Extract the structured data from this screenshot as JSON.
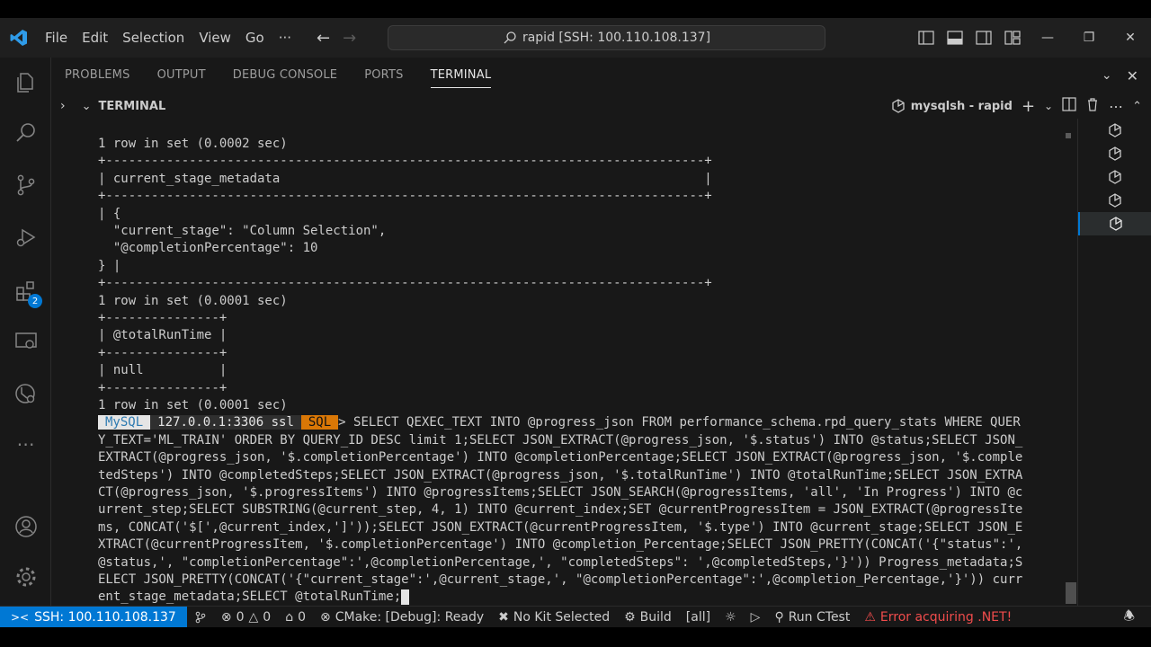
{
  "titlebar": {
    "menu": [
      "File",
      "Edit",
      "Selection",
      "View",
      "Go",
      "···"
    ],
    "command_center": "rapid [SSH: 100.110.108.137]"
  },
  "activity": {
    "extensions_badge": "2"
  },
  "panel": {
    "tabs": [
      "PROBLEMS",
      "OUTPUT",
      "DEBUG CONSOLE",
      "PORTS",
      "TERMINAL"
    ],
    "active_tab": "TERMINAL",
    "terminal_section_title": "TERMINAL",
    "terminal_name": "mysqlsh - rapid"
  },
  "terminal": {
    "lines": [
      "1 row in set (0.0002 sec)",
      "+-------------------------------------------------------------------------------+",
      "| current_stage_metadata                                                        |",
      "+-------------------------------------------------------------------------------+",
      "| {",
      "  \"current_stage\": \"Column Selection\",",
      "  \"@completionPercentage\": 10",
      "} |",
      "+-------------------------------------------------------------------------------+",
      "1 row in set (0.0001 sec)",
      "+---------------+",
      "| @totalRunTime |",
      "+---------------+",
      "| null          |",
      "+---------------+",
      "1 row in set (0.0001 sec)"
    ],
    "prompt": {
      "mysql": "MySQL",
      "host": "127.0.0.1:3306 ssl",
      "mode": "SQL",
      "arrow": ">"
    },
    "command_first": " SELECT QEXEC_TEXT INTO @progress_json FROM performance_schema.rpd_query_stats WHERE QUER",
    "command_lines": [
      "Y_TEXT='ML_TRAIN' ORDER BY QUERY_ID DESC limit 1;SELECT JSON_EXTRACT(@progress_json, '$.status') INTO @status;SELECT JSON_",
      "EXTRACT(@progress_json, '$.completionPercentage') INTO @completionPercentage;SELECT JSON_EXTRACT(@progress_json, '$.comple",
      "tedSteps') INTO @completedSteps;SELECT JSON_EXTRACT(@progress_json, '$.totalRunTime') INTO @totalRunTime;SELECT JSON_EXTRA",
      "CT(@progress_json, '$.progressItems') INTO @progressItems;SELECT JSON_SEARCH(@progressItems, 'all', 'In Progress') INTO @c",
      "urrent_step;SELECT SUBSTRING(@current_step, 4, 1) INTO @current_index;SET @currentProgressItem = JSON_EXTRACT(@progressIte",
      "ms, CONCAT('$[',@current_index,']'));SELECT JSON_EXTRACT(@currentProgressItem, '$.type') INTO @current_stage;SELECT JSON_E",
      "XTRACT(@currentProgressItem, '$.completionPercentage') INTO @completion_Percentage;SELECT JSON_PRETTY(CONCAT('{\"status\":',",
      "@status,', \"completionPercentage\":',@completionPercentage,', \"completedSteps\": ',@completedSteps,'}')) Progress_metadata;S",
      "ELECT JSON_PRETTY(CONCAT('{\"current_stage\":',@current_stage,', \"@completionPercentage\":',@completion_Percentage,'}')) curr"
    ],
    "command_last": "ent_stage_metadata;SELECT @totalRunTime;"
  },
  "statusbar": {
    "remote": "SSH: 100.110.108.137",
    "errors": "0",
    "warnings": "0",
    "ports": "0",
    "cmake": "CMake: [Debug]: Ready",
    "kit": "No Kit Selected",
    "build": "Build",
    "target": "[all]",
    "run_ctest": "Run CTest",
    "dotnet_error": "Error acquiring .NET!"
  },
  "colors": {
    "accent": "#0078d4",
    "sql_badge": "#d97706",
    "error": "#f14c4c"
  }
}
